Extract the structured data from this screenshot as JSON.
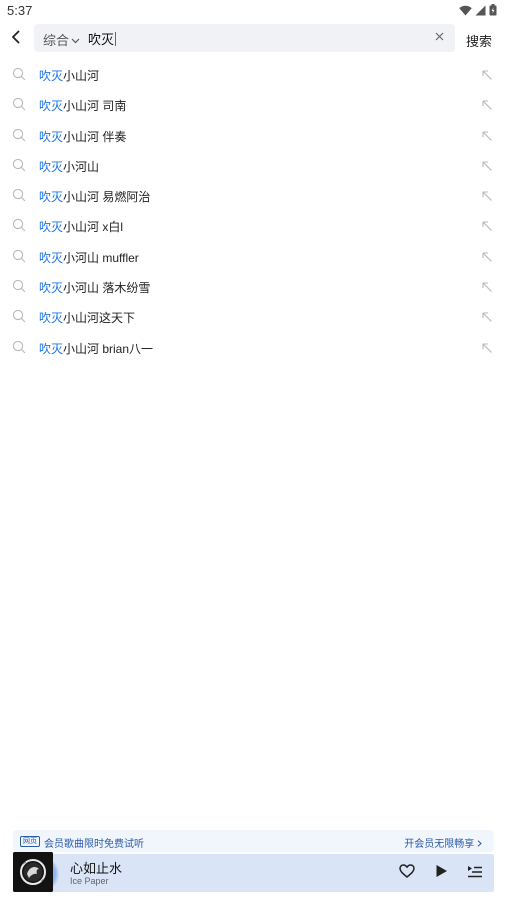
{
  "status": {
    "time": "5:37"
  },
  "search": {
    "category": "综合",
    "query": "吹灭",
    "submit_label": "搜索"
  },
  "suggestions": [
    {
      "highlight": "吹灭",
      "rest": "小山河"
    },
    {
      "highlight": "吹灭",
      "rest": "小山河 司南"
    },
    {
      "highlight": "吹灭",
      "rest": "小山河 伴奏"
    },
    {
      "highlight": "吹灭",
      "rest": "小河山"
    },
    {
      "highlight": "吹灭",
      "rest": "小山河 易燃阿治"
    },
    {
      "highlight": "吹灭",
      "rest": "小山河 x白l"
    },
    {
      "highlight": "吹灭",
      "rest": "小河山 muffler"
    },
    {
      "highlight": "吹灭",
      "rest": "小河山 落木纷雪"
    },
    {
      "highlight": "吹灭",
      "rest": "小山河这天下"
    },
    {
      "highlight": "吹灭",
      "rest": "小山河 brian八一"
    }
  ],
  "promo": {
    "badge": "网页",
    "text": "会员歌曲限时免费试听",
    "link": "开会员无限畅享"
  },
  "player": {
    "title": "心如止水",
    "artist": "Ice Paper"
  },
  "colors": {
    "accent": "#1e74e8",
    "promo_text": "#2b5aa7",
    "player_bg": "#d9e4f7"
  }
}
